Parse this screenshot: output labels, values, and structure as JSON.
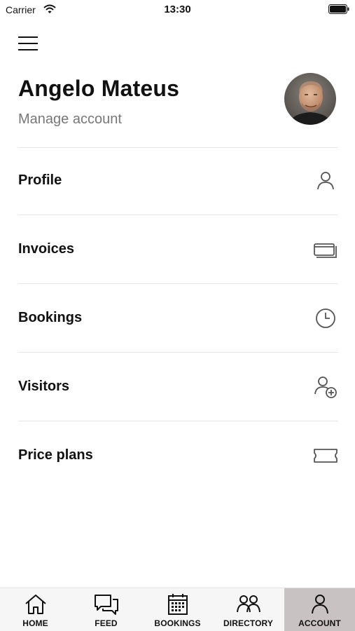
{
  "status_bar": {
    "carrier": "Carrier",
    "time": "13:30"
  },
  "header": {
    "name": "Angelo Mateus",
    "manage_link": "Manage account"
  },
  "menu": [
    {
      "label": "Profile",
      "icon": "person-icon"
    },
    {
      "label": "Invoices",
      "icon": "cards-icon"
    },
    {
      "label": "Bookings",
      "icon": "clock-icon"
    },
    {
      "label": "Visitors",
      "icon": "add-person-icon"
    },
    {
      "label": "Price plans",
      "icon": "ticket-icon"
    }
  ],
  "tabs": [
    {
      "label": "HOME",
      "icon": "home-icon",
      "active": false
    },
    {
      "label": "FEED",
      "icon": "chat-icon",
      "active": false
    },
    {
      "label": "BOOKINGS",
      "icon": "calendar-icon",
      "active": false
    },
    {
      "label": "DIRECTORY",
      "icon": "people-icon",
      "active": false
    },
    {
      "label": "ACCOUNT",
      "icon": "person-icon",
      "active": true
    }
  ],
  "colors": {
    "active_tab_bg": "#c9c2c2",
    "tabbar_bg": "#f7f6f6",
    "subtle_text": "#777777",
    "divider": "#e6e6e6"
  }
}
